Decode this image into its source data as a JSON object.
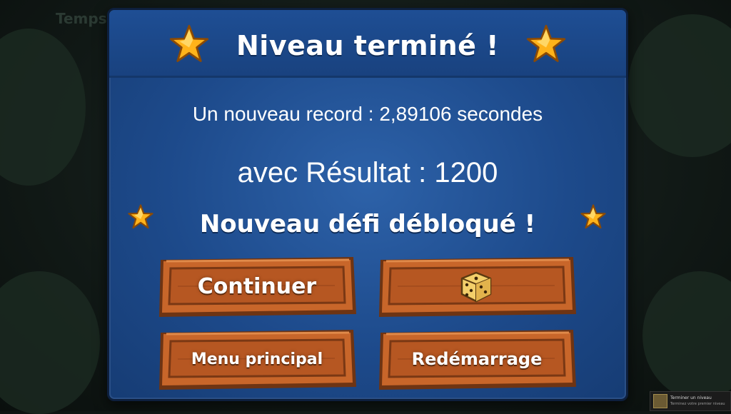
{
  "background": {
    "label": "Temps"
  },
  "dialog": {
    "title": "Niveau terminé !",
    "record": "Un nouveau record : 2,89106 secondes",
    "result": "avec Résultat : 1200",
    "challenge": "Nouveau défi débloqué !",
    "buttons": {
      "continue": "Continuer",
      "random_icon": "dice-icon",
      "main_menu": "Menu principal",
      "restart": "Redémarrage"
    }
  },
  "notification": {
    "title": "Terminer un niveau",
    "subtitle": "Terminez votre premier niveau"
  },
  "colors": {
    "panel": "#1d4a8b",
    "wood": "#c8662a",
    "star": "#ffb31a"
  }
}
